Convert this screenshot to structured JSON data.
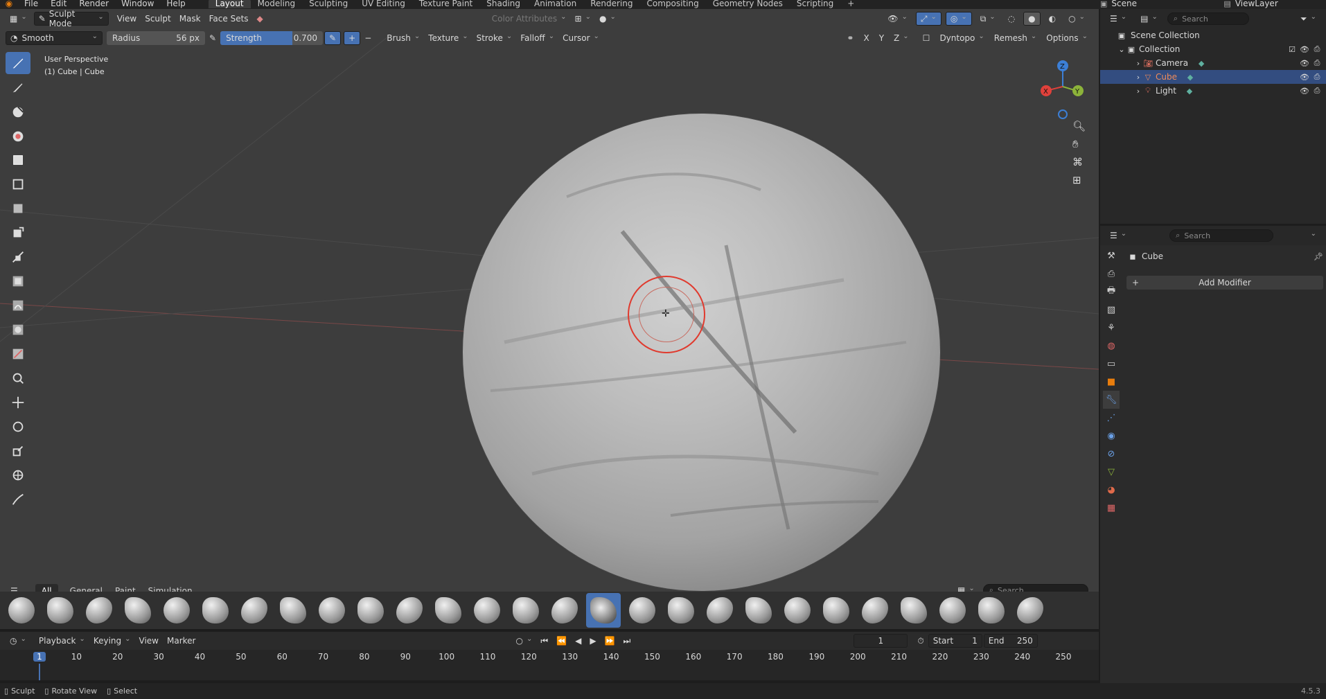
{
  "menu": {
    "items": [
      "File",
      "Edit",
      "Render",
      "Window",
      "Help"
    ],
    "workspaces": [
      "Layout",
      "Modeling",
      "Sculpting",
      "UV Editing",
      "Texture Paint",
      "Shading",
      "Animation",
      "Rendering",
      "Compositing",
      "Geometry Nodes",
      "Scripting"
    ],
    "active_workspace": "Layout",
    "scene": "Scene",
    "view_layer": "ViewLayer"
  },
  "viewport_header": {
    "mode": "Sculpt Mode",
    "menus": [
      "View",
      "Sculpt",
      "Mask",
      "Face Sets"
    ],
    "color_attributes": "Color Attributes"
  },
  "tool_header": {
    "brush": "Smooth",
    "radius_label": "Radius",
    "radius_value": "56 px",
    "strength_label": "Strength",
    "strength_value": "0.700",
    "strength_fraction": 0.7,
    "dropdowns": [
      "Brush",
      "Texture",
      "Stroke",
      "Falloff",
      "Cursor"
    ],
    "axes": [
      "X",
      "Y",
      "Z"
    ],
    "dyntopo": "Dyntopo",
    "remesh": "Remesh",
    "options": "Options"
  },
  "viewport": {
    "perspective": "User Perspective",
    "object_info": "(1) Cube | Cube",
    "gizmo_axes": [
      "Z",
      "X",
      "Y"
    ]
  },
  "brush_shelf": {
    "tabs": [
      "All",
      "General",
      "Paint",
      "Simulation"
    ],
    "active_tab": "All",
    "search_placeholder": "Search",
    "brush_count": 27,
    "active_index": 15
  },
  "timeline": {
    "menus": [
      "Playback",
      "Keying",
      "View",
      "Marker"
    ],
    "current_frame": "1",
    "start_label": "Start",
    "start_value": "1",
    "end_label": "End",
    "end_value": "250",
    "ticks": [
      "1",
      "10",
      "20",
      "30",
      "40",
      "50",
      "60",
      "70",
      "80",
      "90",
      "100",
      "110",
      "120",
      "130",
      "140",
      "150",
      "160",
      "170",
      "180",
      "190",
      "200",
      "210",
      "220",
      "230",
      "240",
      "250"
    ]
  },
  "outliner": {
    "search_placeholder": "Search",
    "scene_collection": "Scene Collection",
    "collection": "Collection",
    "objects": [
      {
        "name": "Camera",
        "selected": false,
        "color": "#d9d9d9"
      },
      {
        "name": "Cube",
        "selected": true,
        "color": "#f08c5a"
      },
      {
        "name": "Light",
        "selected": false,
        "color": "#d9d9d9"
      }
    ]
  },
  "properties": {
    "search_placeholder": "Search",
    "object_name": "Cube",
    "add_modifier": "Add Modifier"
  },
  "status": {
    "sculpt": "Sculpt",
    "rotate_view": "Rotate View",
    "select": "Select",
    "version": "4.5.3"
  },
  "colors": {
    "accent": "#4772b3",
    "brush_ring": "#e03a2e",
    "axis_x": "#e0413b",
    "axis_y": "#8cb33a",
    "axis_z": "#3c7fd6"
  }
}
